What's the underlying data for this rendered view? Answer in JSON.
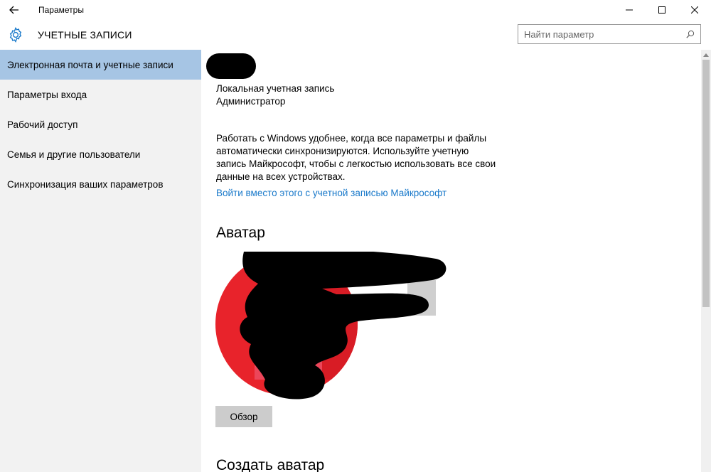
{
  "window": {
    "title": "Параметры",
    "back_icon": "arrow-left-icon",
    "minimize_icon": "minimize-icon",
    "maximize_icon": "maximize-icon",
    "close_icon": "close-icon"
  },
  "header": {
    "icon": "gear-icon",
    "title": "УЧЕТНЫЕ ЗАПИСИ",
    "search_placeholder": "Найти параметр",
    "search_value": "",
    "search_icon": "search-icon"
  },
  "sidebar": {
    "items": [
      {
        "label": "Электронная почта и учетные записи",
        "active": true
      },
      {
        "label": "Параметры входа",
        "active": false
      },
      {
        "label": "Рабочий доступ",
        "active": false
      },
      {
        "label": "Семья и другие пользователи",
        "active": false
      },
      {
        "label": "Синхронизация ваших параметров",
        "active": false
      }
    ]
  },
  "account": {
    "type": "Локальная учетная запись",
    "role": "Администратор",
    "sync_text": "Работать с Windows удобнее, когда все параметры и файлы автоматически синхронизируются. Используйте учетную запись Майкрософт, чтобы с легкостью использовать все свои данные на всех устройствах.",
    "ms_link": "Войти вместо этого с учетной записью Майкрософт"
  },
  "avatar": {
    "heading": "Аватар",
    "browse_label": "Обзор"
  },
  "create_avatar": {
    "heading": "Создать аватар"
  },
  "colors": {
    "accent": "#1979ca",
    "sidebar_bg": "#f2f2f2",
    "active_item": "#a6c5e4",
    "button_bg": "#cccccc",
    "avatar_red": "#e8232b"
  }
}
